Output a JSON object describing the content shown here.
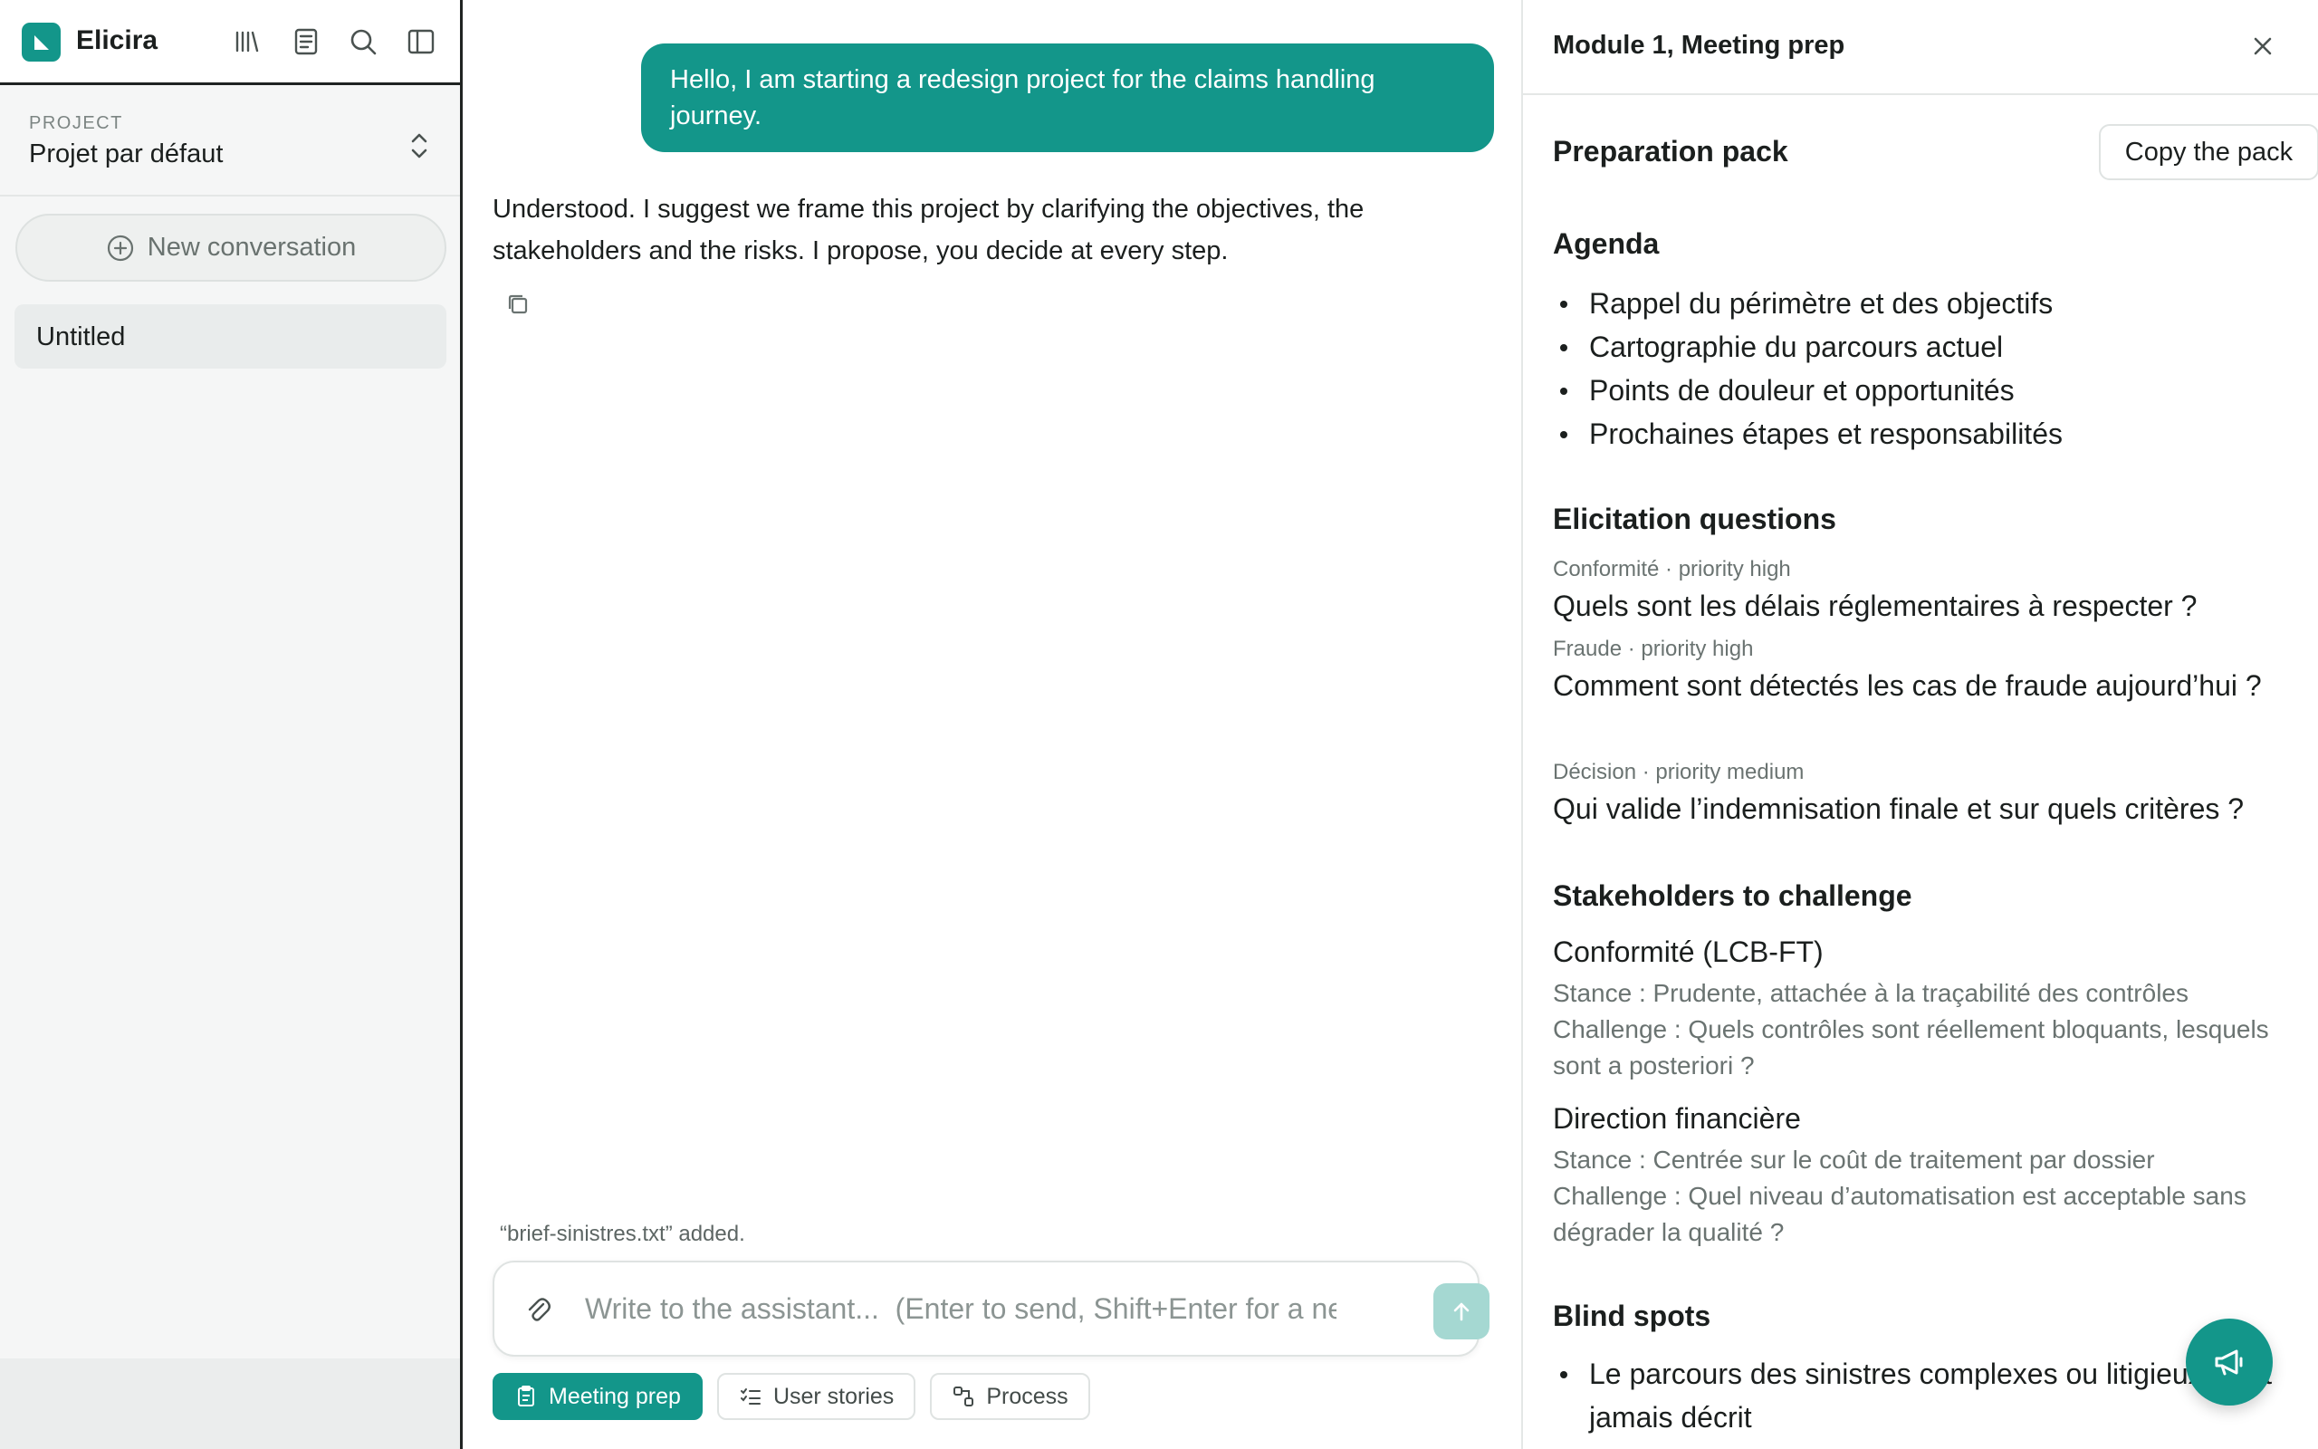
{
  "app": {
    "brand": "Elicira"
  },
  "sidebar": {
    "header_icons": [
      "library-icon",
      "notes-icon",
      "search-icon",
      "sidebar-toggle-icon"
    ],
    "project_label": "PROJECT",
    "project_name": "Projet par défaut",
    "new_conversation": "New conversation",
    "conversations": [
      {
        "title": "Untitled"
      }
    ]
  },
  "chat": {
    "user_message": "Hello, I am starting a redesign project for the claims handling journey.",
    "assistant_message": "Understood. I suggest we frame this project by clarifying the objectives, the stakeholders and the risks. I propose, you decide at every step.",
    "file_note": "“brief-sinistres.txt” added.",
    "composer_placeholder": "Write to the assistant...  (Enter to send, Shift+Enter for a new line)",
    "modes": [
      {
        "label": "Meeting prep",
        "active": true
      },
      {
        "label": "User stories",
        "active": false
      },
      {
        "label": "Process",
        "active": false
      }
    ]
  },
  "panel": {
    "title": "Module 1, Meeting prep",
    "pack_title": "Preparation pack",
    "copy_button": "Copy the pack",
    "agenda_title": "Agenda",
    "agenda": [
      "Rappel du périmètre et des objectifs",
      "Cartographie du parcours actuel",
      "Points de douleur et opportunités",
      "Prochaines étapes et responsabilités"
    ],
    "questions_title": "Elicitation questions",
    "questions": [
      {
        "meta": "Conformité · priority high",
        "text": "Quels sont les délais réglementaires à respecter ?"
      },
      {
        "meta": "Fraude · priority high",
        "text": "Comment sont détectés les cas de fraude aujourd’hui ?"
      },
      {
        "meta": "Décision · priority medium",
        "text": "Qui valide l’indemnisation finale et sur quels critères ?"
      }
    ],
    "stakeholders_title": "Stakeholders to challenge",
    "stakeholders": [
      {
        "name": "Conformité (LCB-FT)",
        "stance": "Stance : Prudente, attachée à la traçabilité des contrôles",
        "challenge": "Challenge : Quels contrôles sont réellement bloquants, lesquels sont a posteriori ?"
      },
      {
        "name": "Direction financière",
        "stance": "Stance : Centrée sur le coût de traitement par dossier",
        "challenge": "Challenge : Quel niveau d’automatisation est acceptable sans dégrader la qualité ?"
      }
    ],
    "blind_spots_title": "Blind spots",
    "blind_spots": [
      "Le parcours des sinistres complexes ou litigieux n’est jamais décrit"
    ]
  },
  "colors": {
    "accent": "#13968a",
    "accent_light": "#a5d8d2",
    "sidebar_bg": "#f5f6f6"
  }
}
